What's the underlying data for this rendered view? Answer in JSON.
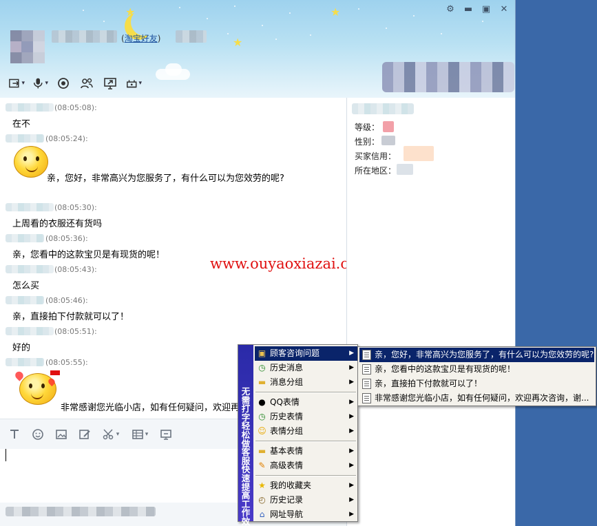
{
  "header": {
    "friend_type_open": "(",
    "friend_type_link": "淘宝好友",
    "friend_type_close": ")",
    "window_controls": [
      "settings-icon",
      "minimize-icon",
      "maximize-icon",
      "close-icon"
    ],
    "toolbar_icons": [
      "transfer-file-icon",
      "voice-icon",
      "video-icon",
      "contacts-icon",
      "screen-share-icon",
      "remote-assist-icon"
    ]
  },
  "chat": {
    "messages": [
      {
        "time": "(08:05:08):",
        "text": "在不"
      },
      {
        "time": "(08:05:24):",
        "text": "亲，您好，非常高兴为您服务了，有什么可以为您效劳的呢?"
      },
      {
        "time": "(08:05:30):",
        "text": "上周看的衣服还有货吗"
      },
      {
        "time": "(08:05:36):",
        "text": "亲，您看中的这款宝贝是有现货的呢！"
      },
      {
        "time": "(08:05:43):",
        "text": "怎么买"
      },
      {
        "time": "(08:05:46):",
        "text": "亲，直接拍下付款就可以了！"
      },
      {
        "time": "(08:05:51):",
        "text": "好的"
      },
      {
        "time": "(08:05:55):",
        "text": "非常感谢您光临小店，如有任何疑问，欢迎再"
      }
    ]
  },
  "watermark": "www.ouyaoxiazai.com",
  "sidebar": {
    "level_label": "等级：",
    "gender_label": "性别：",
    "buyer_credit_label": "买家信用：",
    "location_label": "所在地区："
  },
  "input_tools": [
    "font-icon",
    "emoji-icon",
    "image-icon",
    "edit-icon",
    "cut-icon",
    "table-icon",
    "screenshot-icon"
  ],
  "menu": {
    "strip_text": "无需打字 轻松做客服 快速提高工作效率",
    "items": [
      {
        "label": "顾客咨询问题",
        "icon": "folder-icon"
      },
      {
        "label": "历史消息",
        "icon": "history-icon"
      },
      {
        "label": "消息分组",
        "icon": "folder-icon"
      },
      {
        "label": "QQ表情",
        "icon": "qq-icon"
      },
      {
        "label": "历史表情",
        "icon": "history-icon"
      },
      {
        "label": "表情分组",
        "icon": "smiley-icon"
      },
      {
        "label": "基本表情",
        "icon": "folder-icon"
      },
      {
        "label": "高级表情",
        "icon": "star-edit-icon"
      },
      {
        "label": "我的收藏夹",
        "icon": "star-icon"
      },
      {
        "label": "历史记录",
        "icon": "clock-icon"
      },
      {
        "label": "网址导航",
        "icon": "house-icon"
      }
    ]
  },
  "submenu": {
    "items": [
      {
        "label": "亲，您好，非常高兴为您服务了，有什么可以为您效劳的呢?"
      },
      {
        "label": "亲，您看中的这款宝贝是有现货的呢！"
      },
      {
        "label": "亲，直接拍下付款就可以了！"
      },
      {
        "label": "非常感谢您光临小店，如有任何疑问，欢迎再次咨询，谢..."
      }
    ]
  },
  "colors": {
    "menu_highlight": "#0a246a",
    "menu_strip": "#3232b4",
    "watermark": "#e01010",
    "desktop": "#3a68a8"
  }
}
